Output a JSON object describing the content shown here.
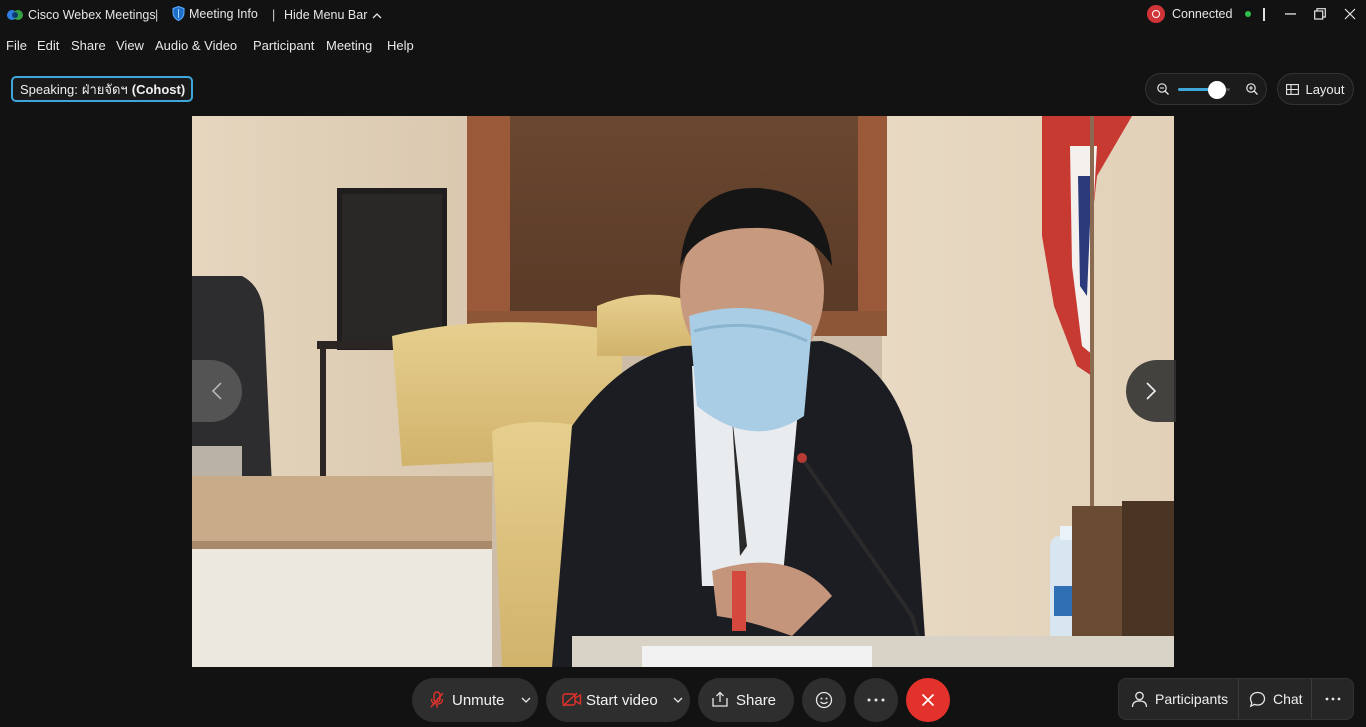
{
  "window": {
    "app_title": "Cisco Webex Meetings",
    "meeting_info_label": "Meeting Info",
    "hide_menu_label": "Hide Menu Bar",
    "connection_status": "Connected",
    "status_color": "#2fbf4f",
    "record_color": "#d13438"
  },
  "menu": {
    "items": [
      "File",
      "Edit",
      "Share",
      "View",
      "Audio & Video",
      "Participant",
      "Meeting",
      "Help"
    ]
  },
  "speaking": {
    "prefix": "Speaking:",
    "name": "ฝ่ายจัดฯ",
    "role": "(Cohost)"
  },
  "zoom": {
    "level": 0.75
  },
  "layout": {
    "label": "Layout"
  },
  "controls": {
    "unmute_label": "Unmute",
    "start_video_label": "Start video",
    "share_label": "Share",
    "participants_label": "Participants",
    "chat_label": "Chat",
    "accent_color": "#3ea6d8",
    "leave_color": "#e3322b"
  }
}
